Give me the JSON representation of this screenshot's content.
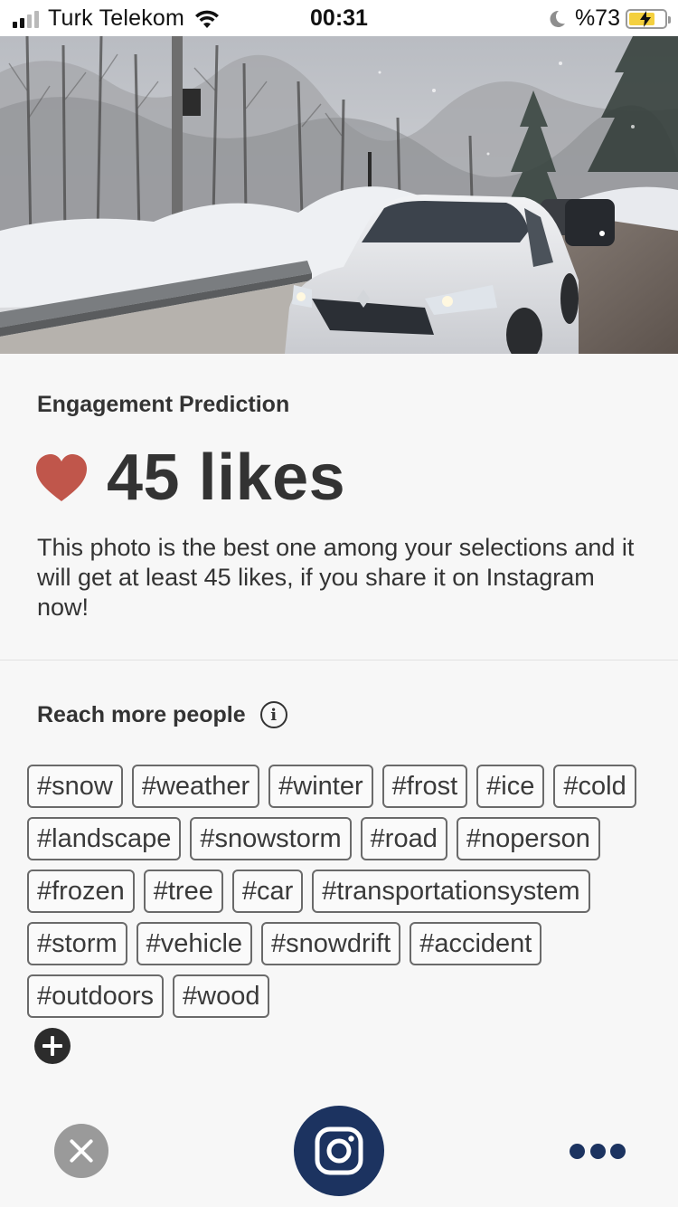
{
  "status_bar": {
    "carrier": "Turk Telekom",
    "time": "00:31",
    "battery_percent": "%73",
    "battery_level": 0.73,
    "icons": [
      "signal-icon",
      "wifi-icon",
      "moon-icon",
      "battery-icon"
    ]
  },
  "photo": {
    "icon": "snowy-road-car-photo"
  },
  "engagement": {
    "title": "Engagement Prediction",
    "likes": "45 likes",
    "description": "This photo is the best one among your selections and it will get at least 45 likes, if you share it on Instagram now!",
    "heart_color": "#c0564b"
  },
  "reach": {
    "title": "Reach more people",
    "info_glyph": "i",
    "tags": [
      "#snow",
      "#weather",
      "#winter",
      "#frost",
      "#ice",
      "#cold",
      "#landscape",
      "#snowstorm",
      "#road",
      "#noperson",
      "#frozen",
      "#tree",
      "#car",
      "#transportationsystem",
      "#storm",
      "#vehicle",
      "#snowdrift",
      "#accident",
      "#outdoors",
      "#wood"
    ]
  },
  "actions": {
    "close": "close-icon",
    "instagram": "instagram-icon",
    "more": "more-dots-icon",
    "brand_color": "#1c3360"
  }
}
